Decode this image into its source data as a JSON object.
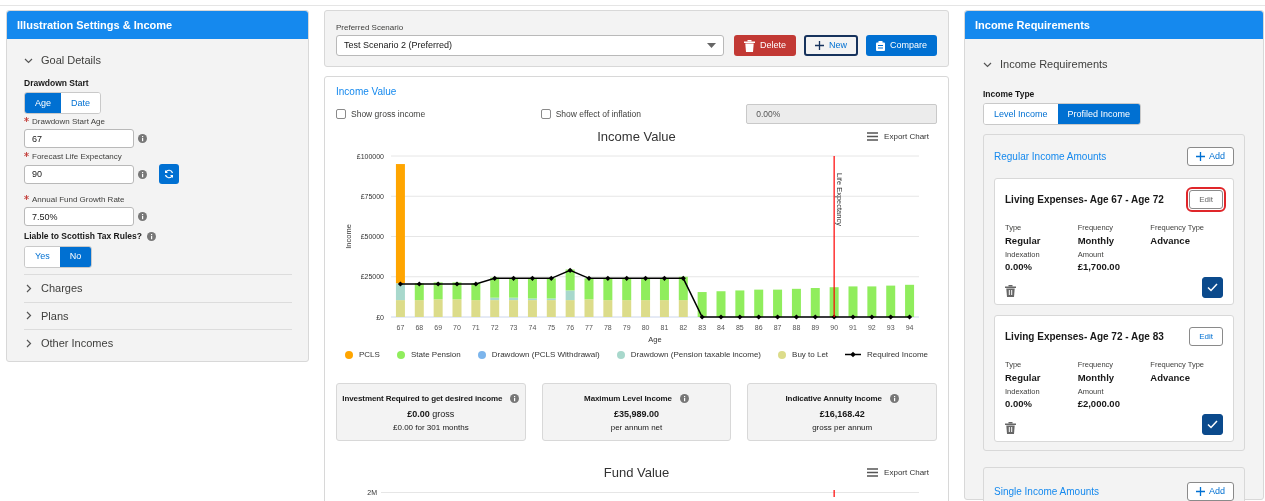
{
  "left_panel": {
    "title": "Illustration Settings & Income",
    "sections": [
      {
        "label": "Goal Details",
        "expanded": true
      },
      {
        "label": "Charges",
        "expanded": false
      },
      {
        "label": "Plans",
        "expanded": false
      },
      {
        "label": "Other Incomes",
        "expanded": false
      }
    ],
    "goal_details": {
      "drawdown_start": {
        "label": "Drawdown Start",
        "options": [
          {
            "label": "Age",
            "selected": true
          },
          {
            "label": "Date",
            "selected": false
          }
        ]
      },
      "fields": [
        {
          "label": "Drawdown Start Age",
          "required": true,
          "value": "67",
          "refresh_button": false
        },
        {
          "label": "Forecast Life Expectancy",
          "required": true,
          "value": "90",
          "refresh_button": true
        },
        {
          "label": "Annual Fund Growth Rate",
          "required": true,
          "value": "7.50%",
          "refresh_button": false
        }
      ],
      "scottish_tax": {
        "label": "Liable to Scottish Tax Rules?",
        "options": [
          {
            "label": "Yes",
            "selected": false
          },
          {
            "label": "No",
            "selected": true
          }
        ]
      }
    }
  },
  "scenario": {
    "label": "Preferred Scenario",
    "value": "Test Scenario 2 (Preferred)",
    "buttons": [
      {
        "label": "Delete",
        "kind": "delete"
      },
      {
        "label": "New",
        "kind": "new"
      },
      {
        "label": "Compare",
        "kind": "compare"
      }
    ]
  },
  "income_value": {
    "link": "Income Value",
    "checkboxes": [
      {
        "label": "Show gross income",
        "checked": false
      },
      {
        "label": "Show effect of inflation",
        "checked": false
      }
    ],
    "inflation_field": {
      "value": "0.00%",
      "disabled": true
    },
    "export": "Export Chart",
    "chart_data": {
      "type": "bar",
      "stacked": true,
      "title": "Income Value",
      "xlabel": "Age",
      "ylabel": "Income",
      "categories": [
        "67",
        "68",
        "69",
        "70",
        "71",
        "72",
        "73",
        "74",
        "75",
        "76",
        "77",
        "78",
        "79",
        "80",
        "81",
        "82",
        "83",
        "84",
        "85",
        "86",
        "87",
        "88",
        "89",
        "90",
        "91",
        "92",
        "93",
        "94"
      ],
      "ylim": [
        0,
        100000
      ],
      "grid": true,
      "yticks": [
        {
          "value": 0,
          "label": "£0"
        },
        {
          "value": 25000,
          "label": "£25000"
        },
        {
          "value": 50000,
          "label": "£50000"
        },
        {
          "value": 75000,
          "label": "£75000"
        },
        {
          "value": 100000,
          "label": "£100000"
        }
      ],
      "series": [
        {
          "name": "PCLS",
          "type": "bar",
          "color": "#ffa500",
          "values": [
            74000,
            null,
            null,
            null,
            null,
            null,
            null,
            null,
            null,
            null,
            null,
            null,
            null,
            null,
            null,
            null,
            null,
            null,
            null,
            null,
            null,
            null,
            null,
            null,
            null,
            null,
            null,
            null
          ]
        },
        {
          "name": "State Pension",
          "type": "bar",
          "color": "#90ed5d",
          "values": [
            null,
            10500,
            10500,
            10500,
            10500,
            12500,
            12000,
            12500,
            12500,
            13000,
            13000,
            13500,
            13500,
            13500,
            13500,
            14500,
            15500,
            16000,
            16500,
            17000,
            17000,
            17500,
            18000,
            18500,
            19000,
            19000,
            19500,
            20000
          ]
        },
        {
          "name": "Drawdown (PCLS Withdrawal)",
          "type": "bar",
          "color": "#7cb5ec",
          "values": [
            null,
            null,
            null,
            null,
            null,
            null,
            null,
            null,
            null,
            null,
            null,
            null,
            null,
            null,
            null,
            null,
            null,
            null,
            null,
            null,
            null,
            null,
            null,
            null,
            null,
            null,
            null,
            null
          ]
        },
        {
          "name": "Drawdown (Pension taxable income)",
          "type": "bar",
          "color": "#a8d8cc",
          "values": [
            10500,
            null,
            null,
            null,
            null,
            1500,
            1500,
            1000,
            1000,
            6000,
            null,
            null,
            null,
            null,
            null,
            null,
            null,
            null,
            null,
            null,
            null,
            null,
            null,
            null,
            null,
            null,
            null,
            null
          ]
        },
        {
          "name": "Buy to Let",
          "type": "bar",
          "color": "#dcdc8a",
          "values": [
            10500,
            10500,
            11000,
            11000,
            10500,
            10500,
            10500,
            10500,
            10500,
            10500,
            11000,
            10500,
            10500,
            10500,
            10500,
            10500,
            null,
            null,
            null,
            null,
            null,
            null,
            null,
            null,
            null,
            null,
            null,
            null
          ]
        },
        {
          "name": "Required Income",
          "type": "line",
          "marker": "diamond",
          "color": "#000000",
          "values": [
            20500,
            20500,
            20500,
            20500,
            20500,
            24000,
            24000,
            24000,
            24000,
            29000,
            24000,
            24000,
            24000,
            24000,
            24000,
            24000,
            0,
            0,
            0,
            0,
            0,
            0,
            0,
            0,
            0,
            0,
            0,
            0
          ]
        }
      ],
      "ref_lines": [
        {
          "axis": "x",
          "value": "90",
          "label": "Life Expectancy",
          "color": "#ff0000"
        }
      ]
    }
  },
  "summaries": [
    {
      "title": "Investment Required to get desired income",
      "value": "**£0.00** gross",
      "note": "£0.00 for 301 months"
    },
    {
      "title": "Maximum Level Income",
      "value": "£35,989.00",
      "note": "per annum net"
    },
    {
      "title": "Indicative Annuity Income",
      "value": "£16,168.42",
      "note": "gross per annum"
    }
  ],
  "fund_value": {
    "title": "Fund Value",
    "export": "Export Chart",
    "y_tick": "2M"
  },
  "right_panel": {
    "title": "Income Requirements",
    "section": {
      "label": "Income Requirements",
      "expanded": true
    },
    "income_type": {
      "label": "Income Type",
      "options": [
        {
          "label": "Level Income",
          "selected": false
        },
        {
          "label": "Profiled Income",
          "selected": true
        }
      ]
    },
    "groups": [
      {
        "title": "Regular Income Amounts",
        "add": "Add",
        "items": [
          {
            "title": "Living Expenses- Age 67 - Age 72",
            "edit": "Edit",
            "highlighted": true,
            "confirmed": true,
            "fields": [
              {
                "label": "Type",
                "value": "Regular"
              },
              {
                "label": "Frequency",
                "value": "Monthly"
              },
              {
                "label": "Frequency Type",
                "value": "Advance"
              },
              {
                "label": "Indexation",
                "value": "0.00%"
              },
              {
                "label": "Amount",
                "value": "£1,700.00"
              }
            ]
          },
          {
            "title": "Living Expenses- Age 72 - Age 83",
            "edit": "Edit",
            "highlighted": false,
            "confirmed": true,
            "fields": [
              {
                "label": "Type",
                "value": "Regular"
              },
              {
                "label": "Frequency",
                "value": "Monthly"
              },
              {
                "label": "Frequency Type",
                "value": "Advance"
              },
              {
                "label": "Indexation",
                "value": "0.00%"
              },
              {
                "label": "Amount",
                "value": "£2,000.00"
              }
            ]
          }
        ]
      },
      {
        "title": "Single Income Amounts",
        "add": "Add"
      }
    ]
  }
}
